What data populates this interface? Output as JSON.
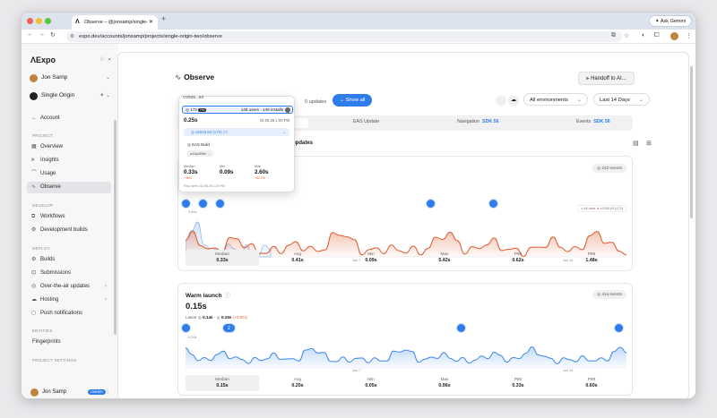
{
  "browser": {
    "tab_title": "Observe – @jonsamp/single-",
    "tab_icon": "expo-logo",
    "gemini_label": "Ask Gemini",
    "url": "expo.dev/accounts/jonsamp/projects/single-origin-two/observe"
  },
  "sidebar": {
    "logo": "Expo",
    "account_name": "Jon Samp",
    "project_name": "Single Origin",
    "back_label": "Account",
    "sections": {
      "project": "PROJECT",
      "develop": "DEVELOP",
      "deploy": "DEPLOY",
      "entities": "ENTITIES",
      "settings": "PROJECT SETTINGS"
    },
    "project_items": [
      {
        "label": "Overview",
        "icon": "grid-icon"
      },
      {
        "label": "Insights",
        "icon": "chart-icon"
      },
      {
        "label": "Usage",
        "icon": "usage-icon"
      },
      {
        "label": "Observe",
        "icon": "pulse-icon"
      }
    ],
    "develop_items": [
      {
        "label": "Workflows",
        "icon": "workflow-icon"
      },
      {
        "label": "Development builds",
        "icon": "gear-icon"
      }
    ],
    "deploy_items": [
      {
        "label": "Builds",
        "icon": "builds-icon"
      },
      {
        "label": "Submissions",
        "icon": "submit-icon"
      },
      {
        "label": "Over-the-air updates",
        "icon": "ota-icon"
      },
      {
        "label": "Hosting",
        "icon": "cloud-icon"
      },
      {
        "label": "Push notifications",
        "icon": "bell-icon"
      }
    ],
    "entity_items": [
      {
        "label": "Fingerprints"
      }
    ],
    "footer_user": "Jon Samp",
    "footer_badge": "OWNER"
  },
  "header": {
    "title": "Observe",
    "handoff_label": "Handoff to AI..."
  },
  "toolbar": {
    "updates_count": "0 updates",
    "show_all_label": "Show all",
    "env_dropdown": "All environments",
    "range_dropdown": "Last 14 Days"
  },
  "filters": {
    "eas_update": "EAS Update",
    "navigation_label": "Navigation",
    "navigation_value": "SDK 56",
    "events_label": "Events",
    "events_value": "SDK 56"
  },
  "updates_heading": "updates",
  "popover": {
    "version": "V2025...63",
    "pill_count": "172",
    "pill_label": "RN",
    "users_installs": "148 users · 149 installs",
    "value": "0.25s",
    "date": "02.06.26 1:00 PM",
    "build_link": "v2026.63 (172)",
    "build_tag": "(0)",
    "eas_build": "EAS Build",
    "hash": "a16a2f9fe",
    "stats": [
      {
        "label": "Median",
        "value": "0.33s",
        "delta": "+36%"
      },
      {
        "label": "Min",
        "value": "0.09s",
        "delta": ""
      },
      {
        "label": "Max",
        "value": "2.60s",
        "delta": "+52.2%"
      }
    ],
    "first_seen": "First seen: 02.06.26 1:29 PM"
  },
  "cold_launch": {
    "events": "242 events",
    "legend_all": "All data",
    "legend_build": "v2026.63 (172)",
    "axis_top": "0.60s",
    "date_labels": [
      "Jun 7",
      "Jun 14"
    ],
    "markers": [
      "",
      "",
      "",
      "",
      ""
    ],
    "stats": [
      {
        "label": "Median",
        "value": "0.33s"
      },
      {
        "label": "Avg",
        "value": "0.41s"
      },
      {
        "label": "Min",
        "value": "0.09s"
      },
      {
        "label": "Max",
        "value": "5.42s"
      },
      {
        "label": "P90",
        "value": "0.62s"
      },
      {
        "label": "P99",
        "value": "1.48s"
      }
    ]
  },
  "warm_launch": {
    "title": "Warm launch",
    "events": "414 events",
    "value": "0.15s",
    "latest_label": "Latest",
    "latest_value": "0.14s",
    "compare_value": "0.15s",
    "compare_delta": "(+0.0%)",
    "axis_top": "0.20s",
    "date_labels": [
      "Jun 7",
      "Jun 14"
    ],
    "markers": [
      "",
      "2",
      "",
      ""
    ],
    "stats": [
      {
        "label": "Median",
        "value": "0.15s"
      },
      {
        "label": "Avg",
        "value": "0.20s"
      },
      {
        "label": "Min",
        "value": "0.05s"
      },
      {
        "label": "Max",
        "value": "0.96s"
      },
      {
        "label": "P90",
        "value": "0.33s"
      },
      {
        "label": "P99",
        "value": "0.60s"
      }
    ]
  },
  "colors": {
    "accent": "#2f7dea",
    "orange": "#e05a2b",
    "blue_series": "#3b86e8"
  }
}
